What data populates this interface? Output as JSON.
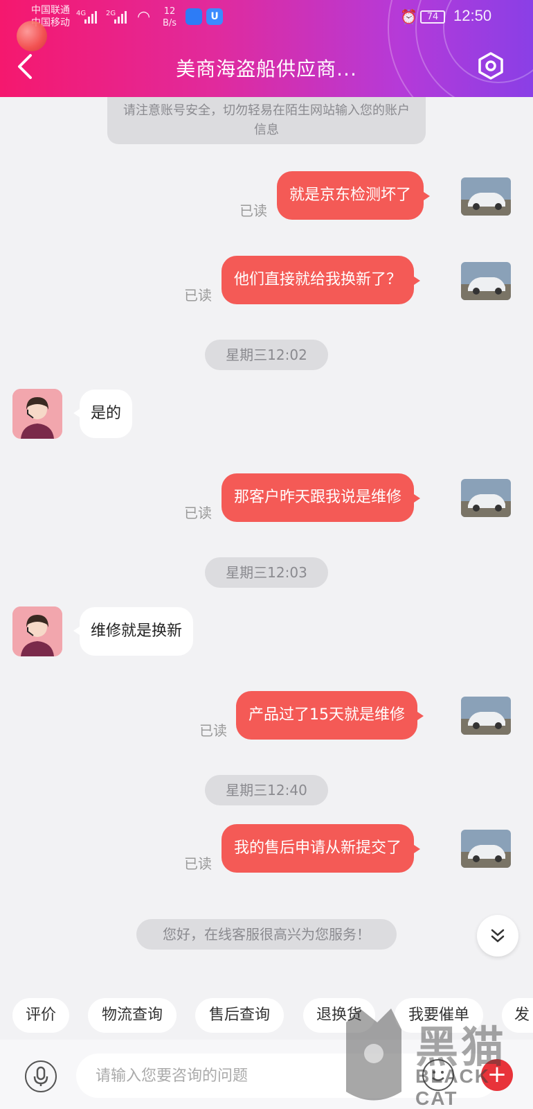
{
  "status_bar": {
    "carrier1": "中国联通",
    "carrier2": "中国移动",
    "net1": "4G",
    "net2": "2G",
    "speed_value": "12",
    "speed_unit": "B/s",
    "battery": "74",
    "time": "12:50"
  },
  "header": {
    "title": "美商海盗船供应商..."
  },
  "chat": {
    "notice": "请注意账号安全，切勿轻易在陌生网站输入您的账户信息",
    "read_label": "已读",
    "messages": [
      {
        "text": "就是京东检测坏了"
      },
      {
        "text": "他们直接就给我换新了？"
      },
      {
        "time": "星期三12:02"
      },
      {
        "text": "是的"
      },
      {
        "text": "那客户昨天跟我说是维修"
      },
      {
        "time": "星期三12:03"
      },
      {
        "text": "维修就是换新"
      },
      {
        "text": "产品过了15天就是维修"
      },
      {
        "time": "星期三12:40"
      },
      {
        "text": "我的售后申请从新提交了"
      }
    ],
    "welcome": "您好，在线客服很高兴为您服务！"
  },
  "quick_actions": [
    "评价",
    "物流查询",
    "售后查询",
    "退换货",
    "我要催单",
    "发"
  ],
  "input": {
    "placeholder": "请输入您要咨询的问题"
  },
  "watermark": {
    "cn": "黑猫",
    "en": "BLACK CAT"
  },
  "colors": {
    "header_start": "#f5186e",
    "header_end": "#8a3fe6",
    "outgoing_bubble": "#f45a56",
    "incoming_bubble": "#ffffff",
    "background": "#f2f2f4"
  }
}
